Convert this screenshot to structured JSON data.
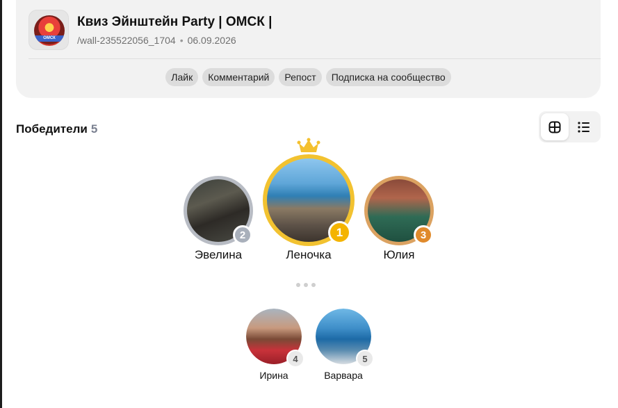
{
  "community": {
    "title": "Квиз Эйнштейн Party | ОМСК |",
    "wall_id": "/wall-235522056_1704",
    "date": "06.09.2026",
    "logo_text": "ОМСК"
  },
  "conditions": [
    "Лайк",
    "Комментарий",
    "Репост",
    "Подписка на сообщество"
  ],
  "winners": {
    "title": "Победители",
    "count": "5",
    "view_modes": [
      "grid-icon",
      "list-icon"
    ]
  },
  "podium": [
    {
      "place": "1",
      "name": "Леночка"
    },
    {
      "place": "2",
      "name": "Эвелина"
    },
    {
      "place": "3",
      "name": "Юлия"
    }
  ],
  "others": [
    {
      "place": "4",
      "name": "Ирина"
    },
    {
      "place": "5",
      "name": "Варвара"
    }
  ],
  "colors": {
    "gold": "#f4b400",
    "silver": "#a9b0bb",
    "bronze": "#e08a2c",
    "card_bg": "#f2f2f2",
    "tag_bg": "#dcdcdc"
  }
}
